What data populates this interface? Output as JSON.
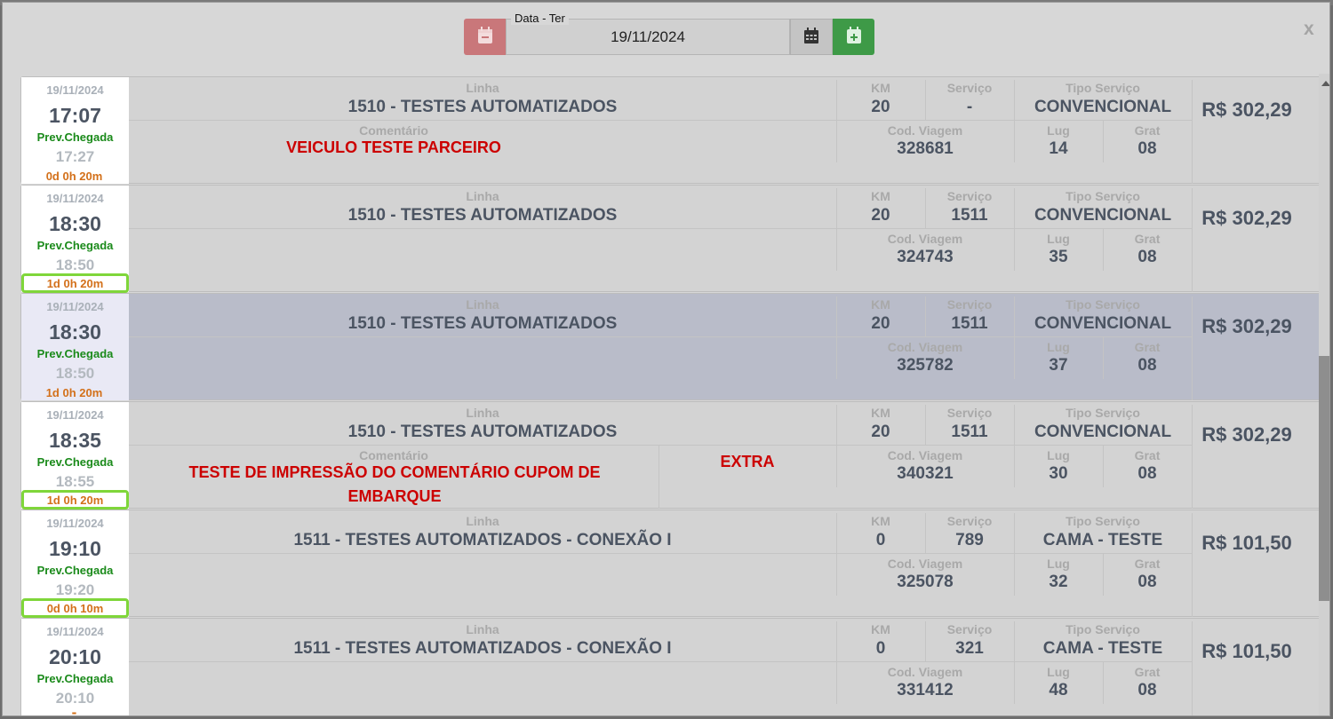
{
  "header": {
    "date_label": "Data - Ter",
    "date_value": "19/11/2024",
    "close_label": "x"
  },
  "labels": {
    "linha": "Linha",
    "km": "KM",
    "servico": "Serviço",
    "tipo_servico": "Tipo Serviço",
    "comentario": "Comentário",
    "cod_viagem": "Cod. Viagem",
    "lug": "Lug",
    "grat": "Grat",
    "prev_chegada": "Prev.Chegada"
  },
  "trips": [
    {
      "date": "19/11/2024",
      "departure": "17:07",
      "arrival": "17:27",
      "duration": "0d 0h 20m",
      "linha": "1510 - TESTES AUTOMATIZADOS",
      "km": "20",
      "servico": "-",
      "tipo_servico": "CONVENCIONAL",
      "comment_label": "Comentário",
      "comment": "VEICULO TESTE PARCEIRO",
      "cod_viagem": "328681",
      "lug": "14",
      "grat": "08",
      "price": "R$ 302,29"
    },
    {
      "date": "19/11/2024",
      "departure": "18:30",
      "arrival": "18:50",
      "duration": "1d 0h 20m",
      "linha": "1510 - TESTES AUTOMATIZADOS",
      "km": "20",
      "servico": "1511",
      "tipo_servico": "CONVENCIONAL",
      "comment_label": "",
      "comment": "",
      "cod_viagem": "324743",
      "lug": "35",
      "grat": "08",
      "price": "R$ 302,29"
    },
    {
      "date": "19/11/2024",
      "departure": "18:30",
      "arrival": "18:50",
      "duration": "1d 0h 20m",
      "linha": "1510 - TESTES AUTOMATIZADOS",
      "km": "20",
      "servico": "1511",
      "tipo_servico": "CONVENCIONAL",
      "comment_label": "",
      "comment": "",
      "cod_viagem": "325782",
      "lug": "37",
      "grat": "08",
      "price": "R$ 302,29"
    },
    {
      "date": "19/11/2024",
      "departure": "18:35",
      "arrival": "18:55",
      "duration": "1d 0h 20m",
      "linha": "1510 - TESTES AUTOMATIZADOS",
      "km": "20",
      "servico": "1511",
      "tipo_servico": "CONVENCIONAL",
      "comment_label": "Comentário",
      "comment": "TESTE DE IMPRESSÃO DO COMENTÁRIO CUPOM DE EMBARQUE",
      "extra": "EXTRA",
      "cod_viagem": "340321",
      "lug": "30",
      "grat": "08",
      "price": "R$ 302,29"
    },
    {
      "date": "19/11/2024",
      "departure": "19:10",
      "arrival": "19:20",
      "duration": "0d 0h 10m",
      "linha": "1511 - TESTES AUTOMATIZADOS - CONEXÃO I",
      "km": "0",
      "servico": "789",
      "tipo_servico": "CAMA - TESTE",
      "comment_label": "",
      "comment": "",
      "cod_viagem": "325078",
      "lug": "32",
      "grat": "08",
      "price": "R$ 101,50"
    },
    {
      "date": "19/11/2024",
      "departure": "20:10",
      "arrival": "20:10",
      "duration": "-",
      "linha": "1511 - TESTES AUTOMATIZADOS - CONEXÃO I",
      "km": "0",
      "servico": "321",
      "tipo_servico": "CAMA - TESTE",
      "comment_label": "",
      "comment": "",
      "cod_viagem": "331412",
      "lug": "48",
      "grat": "08",
      "price": "R$ 101,50"
    }
  ],
  "colors": {
    "prev_button": "#c9777a",
    "next_button": "#3e9a47",
    "highlight": "#7fd63a",
    "comment": "#cc0000",
    "prev_chegada": "#1a8a1a",
    "duration": "#d3701a"
  }
}
